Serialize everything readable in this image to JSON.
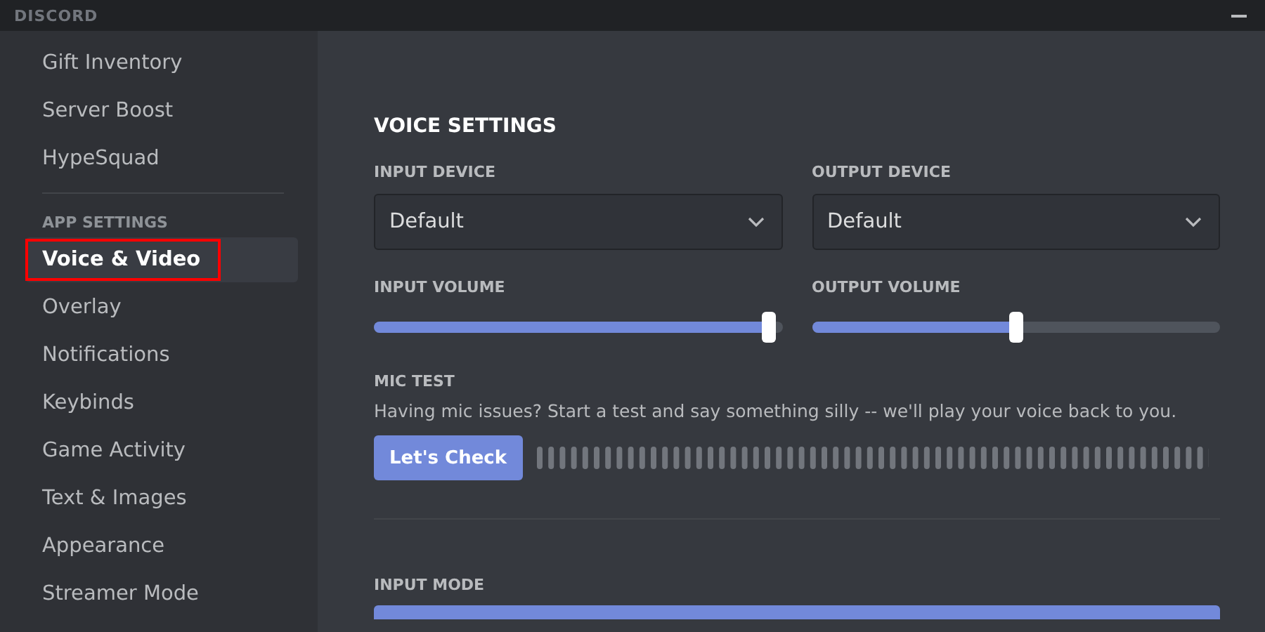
{
  "window": {
    "title": "DISCORD"
  },
  "sidebar": {
    "items": [
      {
        "label": "Gift Inventory",
        "kind": "item",
        "selected": false,
        "highlighted": false
      },
      {
        "label": "Server Boost",
        "kind": "item",
        "selected": false,
        "highlighted": false
      },
      {
        "label": "HypeSquad",
        "kind": "item",
        "selected": false,
        "highlighted": false
      },
      {
        "kind": "divider"
      },
      {
        "label": "APP SETTINGS",
        "kind": "header"
      },
      {
        "label": "Voice & Video",
        "kind": "item",
        "selected": true,
        "highlighted": true
      },
      {
        "label": "Overlay",
        "kind": "item",
        "selected": false,
        "highlighted": false
      },
      {
        "label": "Notifications",
        "kind": "item",
        "selected": false,
        "highlighted": false
      },
      {
        "label": "Keybinds",
        "kind": "item",
        "selected": false,
        "highlighted": false
      },
      {
        "label": "Game Activity",
        "kind": "item",
        "selected": false,
        "highlighted": false
      },
      {
        "label": "Text & Images",
        "kind": "item",
        "selected": false,
        "highlighted": false
      },
      {
        "label": "Appearance",
        "kind": "item",
        "selected": false,
        "highlighted": false
      },
      {
        "label": "Streamer Mode",
        "kind": "item",
        "selected": false,
        "highlighted": false
      }
    ]
  },
  "voice_settings": {
    "title": "VOICE SETTINGS",
    "devices": [
      {
        "label": "INPUT DEVICE",
        "value": "Default"
      },
      {
        "label": "OUTPUT DEVICE",
        "value": "Default"
      }
    ],
    "volumes": [
      {
        "label": "INPUT VOLUME",
        "level": 0.985
      },
      {
        "label": "OUTPUT VOLUME",
        "level": 0.5
      }
    ],
    "mic_test": {
      "label": "MIC TEST",
      "description": "Having mic issues? Start a test and say something silly -- we'll play your voice back to you.",
      "button": "Let's Check"
    },
    "input_mode": {
      "label": "INPUT MODE"
    }
  }
}
